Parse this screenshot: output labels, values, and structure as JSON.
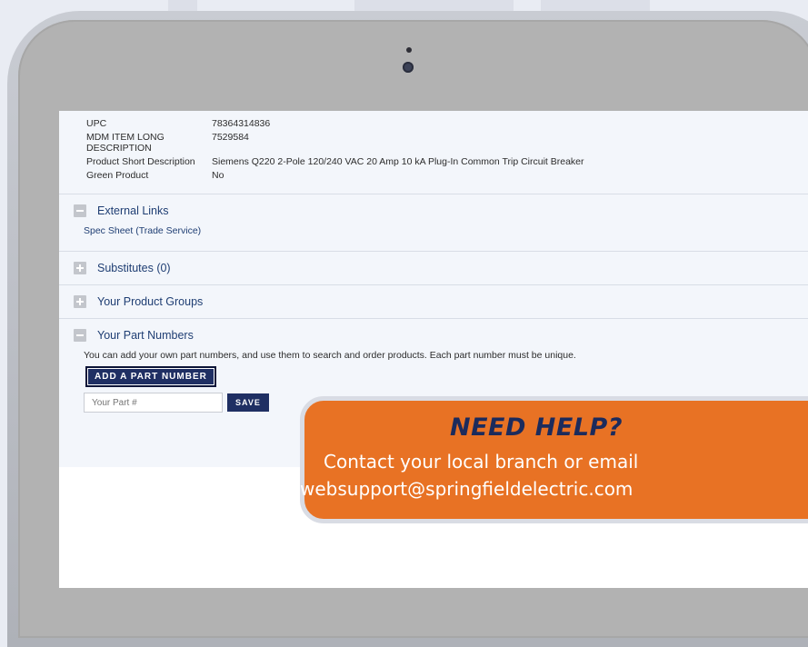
{
  "product_attributes": [
    {
      "label": "UPC",
      "value": "78364314836"
    },
    {
      "label": "MDM ITEM LONG DESCRIPTION",
      "value": "7529584"
    },
    {
      "label": "Product Short Description",
      "value": "Siemens Q220 2-Pole 120/240 VAC 20 Amp 10 kA Plug-In Common Trip Circuit Breaker"
    },
    {
      "label": "Green Product",
      "value": "No"
    }
  ],
  "sections": {
    "external_links": {
      "title": "External Links",
      "expanded": true,
      "link": "Spec Sheet (Trade Service)"
    },
    "substitutes": {
      "title": "Substitutes (0)",
      "expanded": false
    },
    "product_groups": {
      "title": "Your Product Groups",
      "expanded": false
    },
    "part_numbers": {
      "title": "Your Part Numbers",
      "expanded": true,
      "help_text": "You can add your own part numbers, and use them to search and order products. Each part number must be unique.",
      "add_button": "ADD A PART NUMBER",
      "input_placeholder": "Your Part #",
      "save_button": "SAVE"
    }
  },
  "help_banner": {
    "title": "NEED HELP?",
    "line1": "Contact your local branch or email",
    "line2": "websupport@springfieldelectric.com"
  },
  "colors": {
    "accent_navy": "#1f3e73",
    "button_navy": "#1f2f63",
    "banner_orange": "#e87224",
    "banner_title": "#1c2b5c"
  }
}
